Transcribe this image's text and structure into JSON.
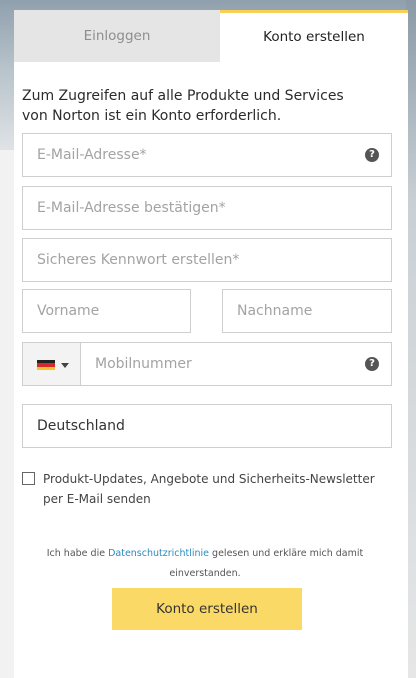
{
  "tabs": {
    "login_label": "Einloggen",
    "create_label": "Konto erstellen"
  },
  "intro_text": "Zum Zugreifen auf alle Produkte und Services von Norton ist ein Konto erforderlich.",
  "form": {
    "email_placeholder": "E-Mail-Adresse*",
    "email_confirm_placeholder": "E-Mail-Adresse bestätigen*",
    "password_placeholder": "Sicheres Kennwort erstellen*",
    "first_name_placeholder": "Vorname",
    "last_name_placeholder": "Nachname",
    "phone_placeholder": "Mobilnummer",
    "country_value": "Deutschland",
    "help_icon_glyph": "?"
  },
  "newsletter_label": "Produkt-Updates, Angebote und Sicherheits-Newsletter per E-Mail senden",
  "consent": {
    "prefix": "Ich habe die ",
    "link_text": "Datenschutzrichtlinie",
    "suffix": " gelesen und erkläre mich damit einverstanden."
  },
  "submit_label": "Konto erstellen",
  "colors": {
    "accent": "#fbd966",
    "tab_border": "#f6d155",
    "link": "#2a8bc0"
  }
}
